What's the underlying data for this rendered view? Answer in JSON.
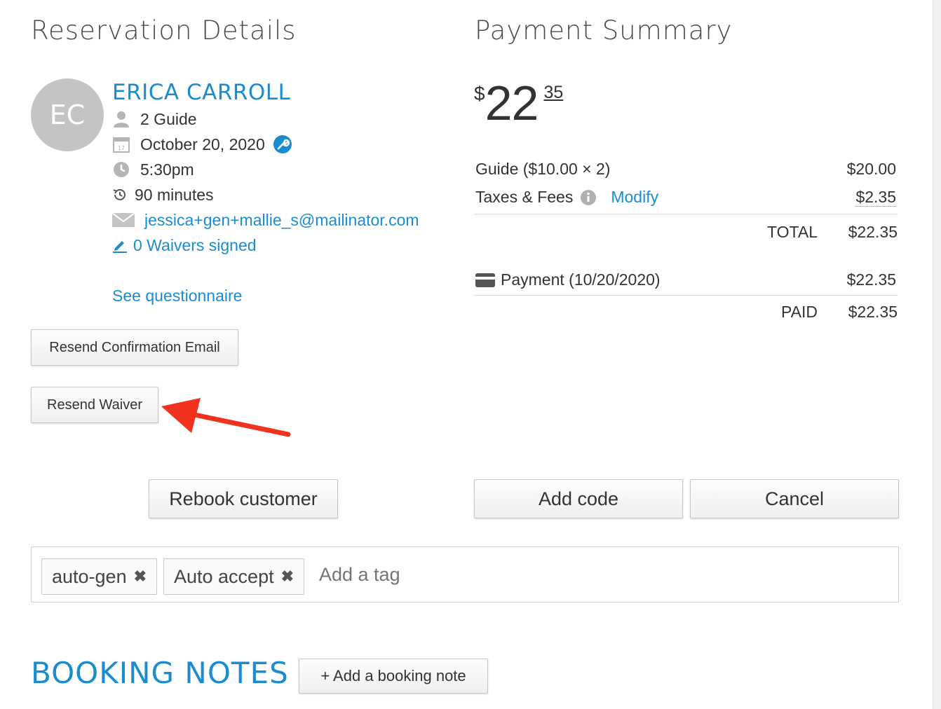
{
  "reservation": {
    "title": "Reservation Details",
    "avatar_initials": "EC",
    "customer_name": "ERICA CARROLL",
    "guests": "2 Guide",
    "date": "October 20, 2020",
    "time": "5:30pm",
    "duration": "90 minutes",
    "email": "jessica+gen+mallie_s@mailinator.com",
    "waivers": "0 Waivers signed",
    "questionnaire_link": "See questionnaire",
    "resend_confirmation_label": "Resend Confirmation Email",
    "resend_waiver_label": "Resend Waiver",
    "rebook_label": "Rebook customer"
  },
  "payment": {
    "title": "Payment Summary",
    "amount_currency": "$",
    "amount_whole": "22",
    "amount_cents": "35",
    "line_item_label": "Guide ($10.00 × 2)",
    "line_item_value": "$20.00",
    "taxes_label": "Taxes & Fees",
    "modify_link": "Modify",
    "taxes_value": "$2.35",
    "total_label": "TOTAL",
    "total_value": "$22.35",
    "payment_label": "Payment (10/20/2020)",
    "payment_value": "$22.35",
    "paid_label": "PAID",
    "paid_value": "$22.35",
    "add_code_label": "Add code",
    "cancel_label": "Cancel"
  },
  "tags": {
    "items": [
      "auto-gen",
      "Auto accept"
    ],
    "placeholder": "Add a tag"
  },
  "booking_notes": {
    "title": "BOOKING NOTES",
    "add_note_label": "+ Add a booking note"
  },
  "colors": {
    "link": "#1a8ccf",
    "annotation_arrow": "#f0321e"
  }
}
